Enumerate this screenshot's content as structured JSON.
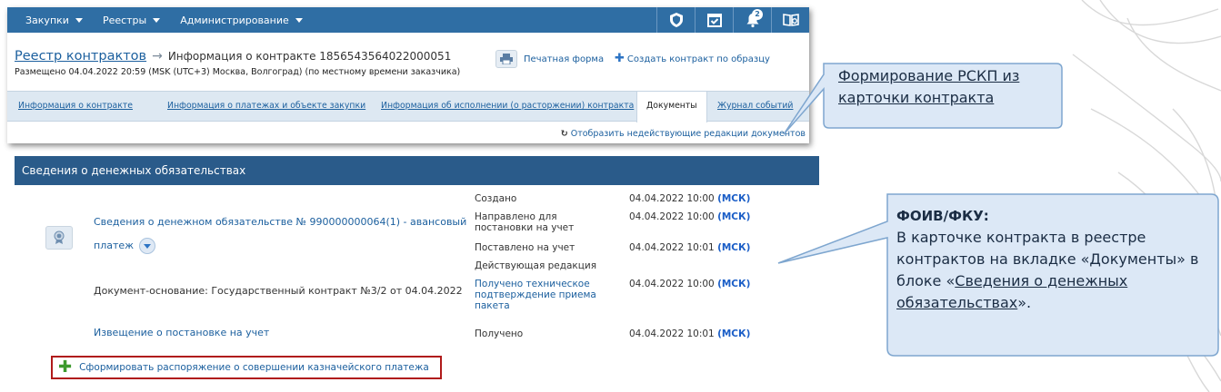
{
  "topnav": {
    "items": [
      {
        "label": "Закупки"
      },
      {
        "label": "Реестры"
      },
      {
        "label": "Администрирование"
      }
    ],
    "bell_count": "2"
  },
  "header": {
    "registry_link": "Реестр контрактов",
    "arrow": "→",
    "current": "Информация о контракте 1856543564022000051",
    "posted": "Размещено 04.04.2022 20:59 (MSK (UTC+3) Москва, Волгоград) (по местному времени заказчика)",
    "print": "Печатная форма",
    "create": "Создать контракт по образцу"
  },
  "tabs": [
    {
      "label": "Информация о контракте"
    },
    {
      "label": "Информация о платежах и объекте закупки"
    },
    {
      "label": "Информация об исполнении (о расторжении) контракта"
    },
    {
      "label": "Документы"
    },
    {
      "label": "Журнал событий"
    }
  ],
  "show_invalid": "Отобразить недействующие редакции документов",
  "panel": {
    "title": "Сведения о денежных обязательствах",
    "doc_title_line1": "Сведения о денежном обязательстве № 990000000064(1) - авансовый",
    "doc_title_line2": "платеж",
    "basis": "Документ-основание: Государственный контракт №3/2 от 04.04.2022",
    "notice": "Извещение о постановке на учет",
    "statuses": [
      {
        "label": "Создано",
        "date": "04.04.2022 10:00",
        "tz": "(МСК)"
      },
      {
        "label": "Направлено для постановки на учет",
        "date": "04.04.2022 10:00",
        "tz": "(МСК)"
      },
      {
        "label": "Поставлено на учет",
        "date": "04.04.2022 10:01",
        "tz": "(МСК)"
      },
      {
        "label": "Действующая редакция",
        "date": "",
        "tz": ""
      },
      {
        "label": "Получено техническое подтверждение приема пакета",
        "date": "04.04.2022 10:00",
        "tz": "(МСК)"
      },
      {
        "label": "Получено",
        "date": "04.04.2022 10:01",
        "tz": "(МСК)"
      }
    ],
    "form_button": "Сформировать распоряжение о совершении казначейского платежа"
  },
  "callouts": {
    "c1": "Формирование РСКП из карточки контракта",
    "c2_head": "ФОИВ/ФКУ:",
    "c2_body1": "В карточке контракта в реестре контрактов на вкладке «Документы» в блоке «",
    "c2_link": "Сведения о денежных обязательствах",
    "c2_end": "»."
  },
  "colors": {
    "nav": "#2f6ea4",
    "panel_header": "#2a5b8a",
    "link": "#1b5f9e",
    "callout_fill": "#dce8f6",
    "callout_border": "#7ea6cf",
    "highlight": "#b01a1a"
  }
}
